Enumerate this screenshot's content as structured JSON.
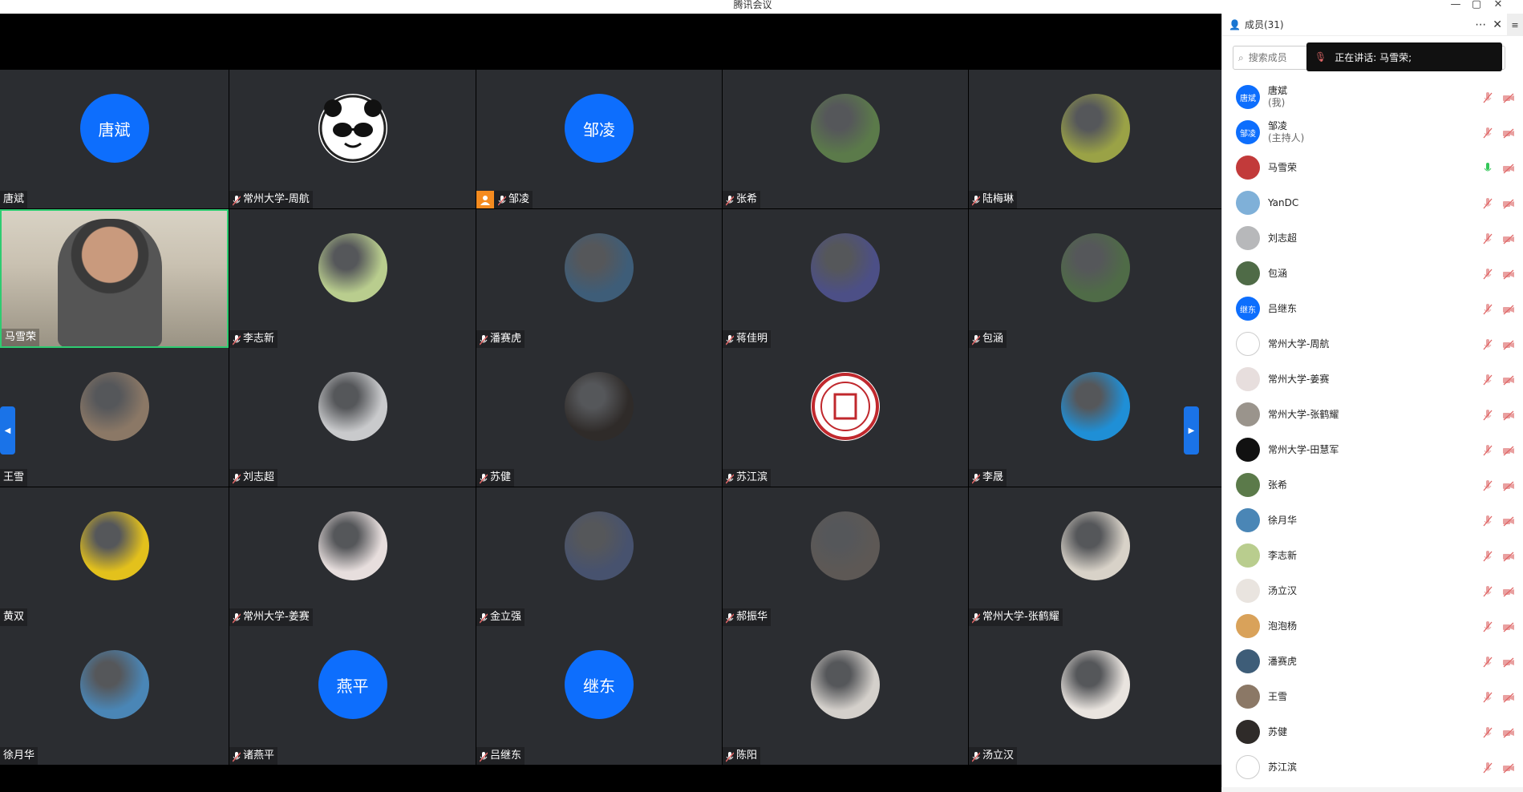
{
  "window": {
    "title": "腾讯会议",
    "controls": [
      "—",
      "▢",
      "✕"
    ]
  },
  "speaking_banner": {
    "label": "正在讲话: 马雪荣;"
  },
  "panel": {
    "header_title": "成员(31)",
    "more_label": "⋯",
    "close_label": "✕",
    "toggle_label": "≡",
    "search_placeholder": "搜索成员"
  },
  "tiles": [
    {
      "name": "唐斌",
      "avatar_text": "唐斌",
      "avatar_kind": "blue",
      "muted_icon": false
    },
    {
      "name": "常州大学-周航",
      "avatar_kind": "panda",
      "muted_icon": true
    },
    {
      "name": "邹凌",
      "avatar_text": "邹凌",
      "avatar_kind": "blue",
      "muted_icon": true,
      "host": true
    },
    {
      "name": "张希",
      "avatar_kind": "photo",
      "color": "#5b7a4a",
      "muted_icon": true
    },
    {
      "name": "陆梅琳",
      "avatar_kind": "photo",
      "color": "#9aa246",
      "muted_icon": true
    },
    {
      "name": "马雪荣",
      "avatar_kind": "video",
      "muted_icon": false
    },
    {
      "name": "李志新",
      "avatar_kind": "photo",
      "color": "#b9cd8e",
      "muted_icon": true
    },
    {
      "name": "潘赛虎",
      "avatar_kind": "photo",
      "color": "#3e5d78",
      "muted_icon": true
    },
    {
      "name": "蒋佳明",
      "avatar_kind": "photo",
      "color": "#4c4f86",
      "muted_icon": true
    },
    {
      "name": "包涵",
      "avatar_kind": "photo",
      "color": "#4f6b47",
      "muted_icon": true
    },
    {
      "name": "王雪",
      "avatar_kind": "photo",
      "color": "#8b7866",
      "muted_icon": false
    },
    {
      "name": "刘志超",
      "avatar_kind": "photo",
      "color": "#c9cacc",
      "muted_icon": true
    },
    {
      "name": "苏健",
      "avatar_kind": "photo",
      "color": "#2f2b29",
      "muted_icon": true
    },
    {
      "name": "苏江滨",
      "avatar_kind": "seal",
      "muted_icon": true
    },
    {
      "name": "李晟",
      "avatar_kind": "photo",
      "color": "#1f8fd6",
      "muted_icon": true
    },
    {
      "name": "黄双",
      "avatar_kind": "photo",
      "color": "#e3c11c",
      "muted_icon": false
    },
    {
      "name": "常州大学-姜赛",
      "avatar_kind": "photo",
      "color": "#e7dedd",
      "muted_icon": true
    },
    {
      "name": "金立强",
      "avatar_kind": "photo",
      "color": "#47526e",
      "muted_icon": true
    },
    {
      "name": "郝振华",
      "avatar_kind": "photo",
      "color": "#5d5855",
      "muted_icon": true
    },
    {
      "name": "常州大学-张鹤耀",
      "avatar_kind": "photo",
      "color": "#d8d2c8",
      "muted_icon": true
    },
    {
      "name": "徐月华",
      "avatar_kind": "photo",
      "color": "#4a86b6",
      "muted_icon": false
    },
    {
      "name": "诸燕平",
      "avatar_text": "燕平",
      "avatar_kind": "blue",
      "muted_icon": true
    },
    {
      "name": "吕继东",
      "avatar_text": "继东",
      "avatar_kind": "blue",
      "muted_icon": true
    },
    {
      "name": "陈阳",
      "avatar_kind": "photo",
      "color": "#d4d0cb",
      "muted_icon": true
    },
    {
      "name": "汤立汉",
      "avatar_kind": "photo",
      "color": "#e9e4df",
      "muted_icon": true
    }
  ],
  "members": [
    {
      "name": "唐斌",
      "sub": "(我)",
      "avatar_text": "唐斌",
      "avatar_color": "#0d6efd",
      "mic": "muted"
    },
    {
      "name": "邹凌",
      "sub": "(主持人)",
      "avatar_text": "邹凌",
      "avatar_color": "#0d6efd",
      "mic": "muted"
    },
    {
      "name": "马雪荣",
      "avatar_color": "#c23a3a",
      "mic": "active"
    },
    {
      "name": "YanDC",
      "avatar_color": "#7fb0d8",
      "mic": "muted"
    },
    {
      "name": "刘志超",
      "avatar_color": "#b7b8ba",
      "mic": "muted"
    },
    {
      "name": "包涵",
      "avatar_color": "#4f6b47",
      "mic": "muted"
    },
    {
      "name": "吕继东",
      "avatar_text": "继东",
      "avatar_color": "#0d6efd",
      "mic": "muted"
    },
    {
      "name": "常州大学-周航",
      "avatar_color": "#ffffff",
      "mic": "muted"
    },
    {
      "name": "常州大学-姜赛",
      "avatar_color": "#e7dedd",
      "mic": "muted"
    },
    {
      "name": "常州大学-张鹤耀",
      "avatar_color": "#9a948c",
      "mic": "muted"
    },
    {
      "name": "常州大学-田慧军",
      "avatar_color": "#111111",
      "mic": "muted"
    },
    {
      "name": "张希",
      "avatar_color": "#5b7a4a",
      "mic": "muted"
    },
    {
      "name": "徐月华",
      "avatar_color": "#4a86b6",
      "mic": "muted"
    },
    {
      "name": "李志新",
      "avatar_color": "#b9cd8e",
      "mic": "muted"
    },
    {
      "name": "汤立汉",
      "avatar_color": "#e9e4df",
      "mic": "muted"
    },
    {
      "name": "泡泡杨",
      "avatar_color": "#d9a25a",
      "mic": "muted"
    },
    {
      "name": "潘赛虎",
      "avatar_color": "#3e5d78",
      "mic": "muted"
    },
    {
      "name": "王雪",
      "avatar_color": "#8b7866",
      "mic": "muted"
    },
    {
      "name": "苏健",
      "avatar_color": "#2f2b29",
      "mic": "muted"
    },
    {
      "name": "苏江滨",
      "avatar_color": "#ffffff",
      "mic": "muted"
    }
  ],
  "colors": {
    "accent": "#0d6efd",
    "tile_bg": "#2b2d31",
    "stage_bg": "#000000",
    "mic_muted": "#e06666",
    "mic_active": "#34c759"
  }
}
